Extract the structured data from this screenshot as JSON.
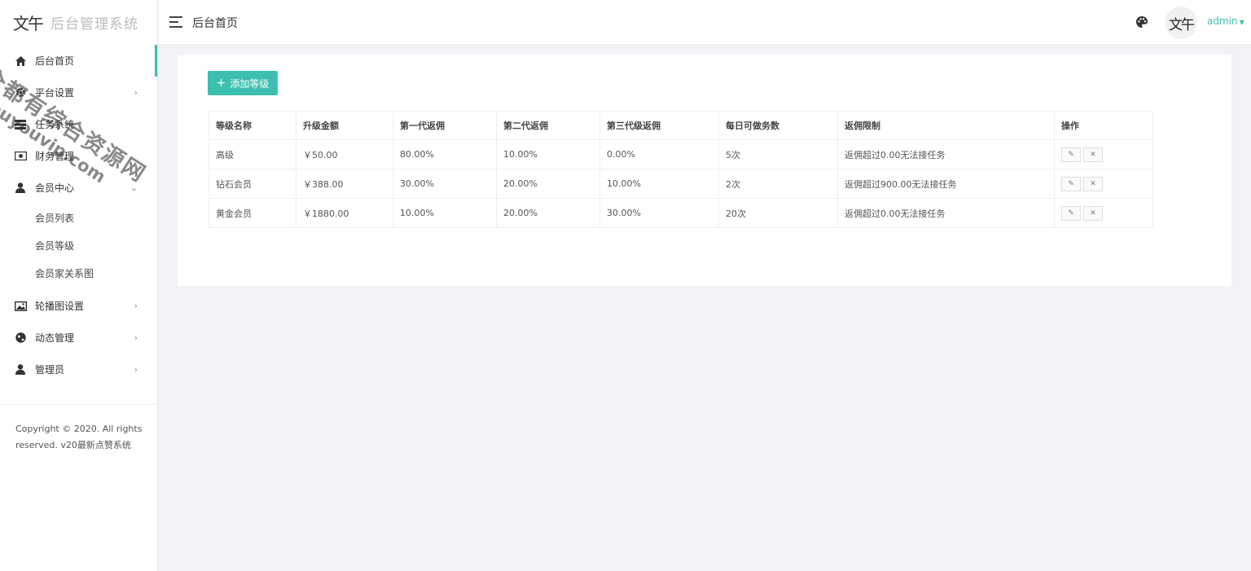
{
  "brand": {
    "logo_text": "后台管理系统",
    "logo_mark": "文午"
  },
  "header": {
    "title": "后台首页",
    "user_name": "admin",
    "avatar_text": "文午"
  },
  "sidebar": {
    "items": [
      {
        "label": "后台首页",
        "icon": "home-icon"
      },
      {
        "label": "平台设置",
        "icon": "gear-icon"
      },
      {
        "label": "任务系统",
        "icon": "list-icon"
      },
      {
        "label": "财务管理",
        "icon": "money-icon"
      },
      {
        "label": "会员中心",
        "icon": "user-icon"
      },
      {
        "label": "轮播图设置",
        "icon": "image-icon"
      },
      {
        "label": "动态管理",
        "icon": "globe-icon"
      },
      {
        "label": "管理员",
        "icon": "admin-icon"
      }
    ],
    "member_sub": [
      {
        "label": "会员列表"
      },
      {
        "label": "会员等级"
      },
      {
        "label": "会员家关系图"
      }
    ],
    "copyright_line1": "Copyright © 2020. All rights",
    "copyright_line2": "reserved. v20最新点赞系统"
  },
  "toolbar": {
    "add_label": "添加等级"
  },
  "table": {
    "headers": [
      "等级名称",
      "升级金额",
      "第一代返佣",
      "第二代返佣",
      "第三代级返佣",
      "每日可做务数",
      "返佣限制",
      "操作"
    ],
    "rows": [
      [
        "高级",
        "￥50.00",
        "80.00%",
        "10.00%",
        "0.00%",
        "5次",
        "返佣超过0.00无法接任务"
      ],
      [
        "钻石会员",
        "￥388.00",
        "30.00%",
        "20.00%",
        "10.00%",
        "2次",
        "返佣超过900.00无法接任务"
      ],
      [
        "黄金会员",
        "￥1880.00",
        "10.00%",
        "20.00%",
        "30.00%",
        "20次",
        "返佣超过0.00无法接任务"
      ]
    ]
  },
  "watermark": {
    "line1": "全都有综合资源网",
    "line2": "douyouvip.com"
  },
  "colors": {
    "accent": "#3dbfb0",
    "background": "#f2f3f7"
  }
}
